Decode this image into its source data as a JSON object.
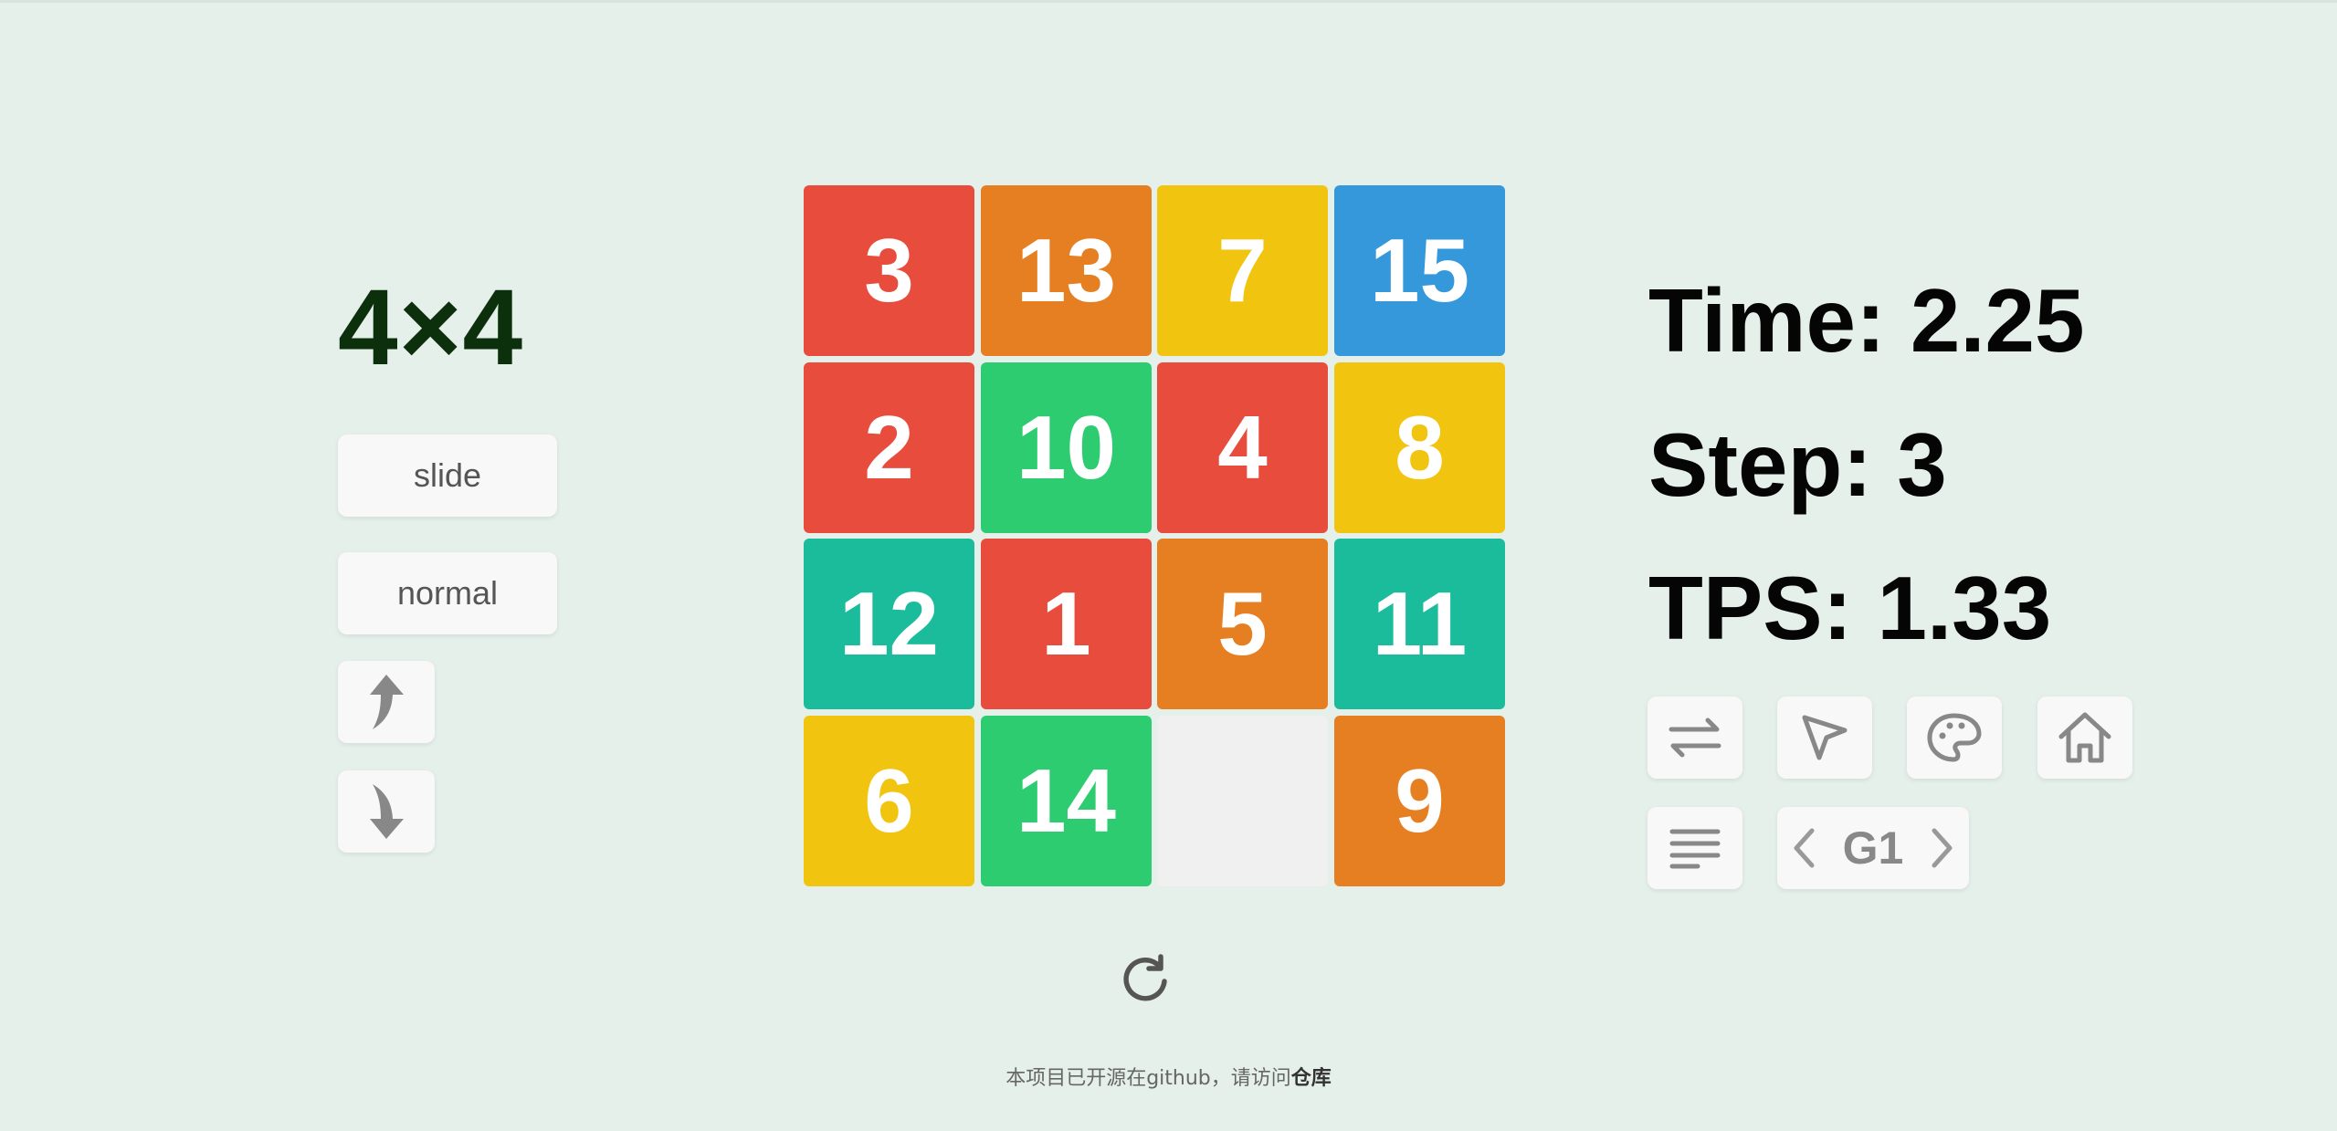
{
  "puzzle": {
    "size_label": "4×4",
    "mode_button": "slide",
    "difficulty_button": "normal",
    "up_icon": "curved-arrow-up-icon",
    "down_icon": "curved-arrow-down-icon"
  },
  "board": {
    "rows": 4,
    "cols": 4,
    "tiles": [
      [
        {
          "n": "3",
          "color": "#e74c3c"
        },
        {
          "n": "13",
          "color": "#e67e22"
        },
        {
          "n": "7",
          "color": "#f1c40f"
        },
        {
          "n": "15",
          "color": "#3498db"
        }
      ],
      [
        {
          "n": "2",
          "color": "#e74c3c"
        },
        {
          "n": "10",
          "color": "#2ecc71"
        },
        {
          "n": "4",
          "color": "#e74c3c"
        },
        {
          "n": "8",
          "color": "#f1c40f"
        }
      ],
      [
        {
          "n": "12",
          "color": "#1abc9c"
        },
        {
          "n": "1",
          "color": "#e74c3c"
        },
        {
          "n": "5",
          "color": "#e67e22"
        },
        {
          "n": "11",
          "color": "#1abc9c"
        }
      ],
      [
        {
          "n": "6",
          "color": "#f1c40f"
        },
        {
          "n": "14",
          "color": "#2ecc71"
        },
        {
          "n": "",
          "color": "#f0f0f0"
        },
        {
          "n": "9",
          "color": "#e67e22"
        }
      ]
    ]
  },
  "stats": {
    "time": "Time: 2.25",
    "step": "Step: 3",
    "tps": "TPS: 1.33"
  },
  "toolbar": {
    "icons": [
      "swap-arrows-icon",
      "cursor-pointer-icon",
      "palette-icon",
      "home-icon",
      "menu-lines-icon"
    ],
    "game_label": "G1"
  },
  "footer": {
    "text": "本项目已开源在github，请访问",
    "link": "仓库"
  }
}
